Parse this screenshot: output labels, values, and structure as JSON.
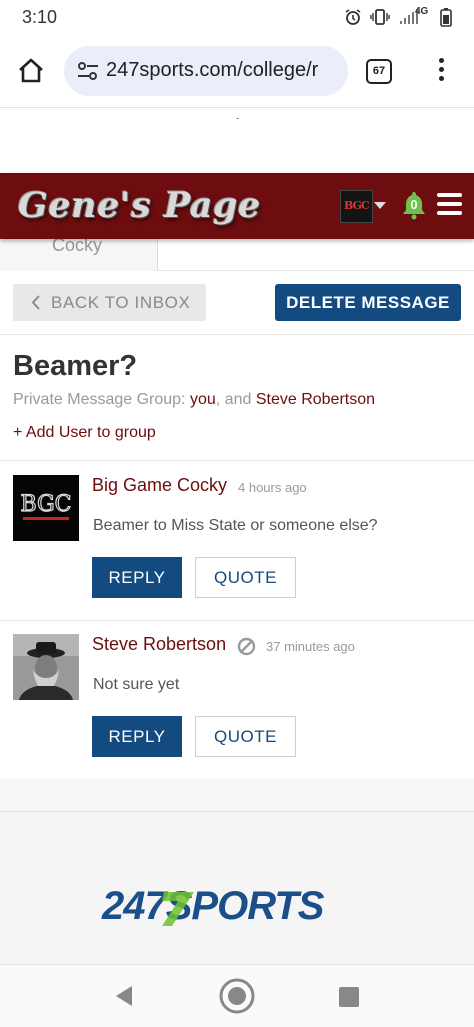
{
  "status_bar": {
    "time": "3:10",
    "network": "4G",
    "icons": [
      "alarm-icon",
      "vibrate-icon",
      "signal-icon",
      "battery-icon"
    ]
  },
  "browser": {
    "url": "247sports.com/college/r",
    "tab_count": "67",
    "icons": [
      "home-icon",
      "tune-icon",
      "menu-dots-icon"
    ]
  },
  "site": {
    "logo": "Gene's Page",
    "avatar_text": "BGC",
    "notification_count": "0",
    "brand_color": "#6d0d0f",
    "accent_color": "#134a80",
    "tab_label": "Cocky"
  },
  "actions": {
    "back_label": "BACK TO INBOX",
    "delete_label": "DELETE MESSAGE"
  },
  "thread": {
    "subject": "Beamer?",
    "group_prefix": "Private Message Group:",
    "member_you": "you",
    "separator": ", and",
    "member_other": "Steve Robertson",
    "add_user_label": "+ Add User to group"
  },
  "messages": [
    {
      "author": "Big Game Cocky",
      "time": "4 hours ago",
      "body": "Beamer to Miss State or someone else?",
      "avatar_text": "BGC",
      "reply_label": "REPLY",
      "quote_label": "QUOTE"
    },
    {
      "author": "Steve Robertson",
      "time": "37 minutes ago",
      "body": "Not sure yet",
      "reply_label": "REPLY",
      "quote_label": "QUOTE"
    }
  ],
  "footer": {
    "brand": "247SPORTS"
  }
}
